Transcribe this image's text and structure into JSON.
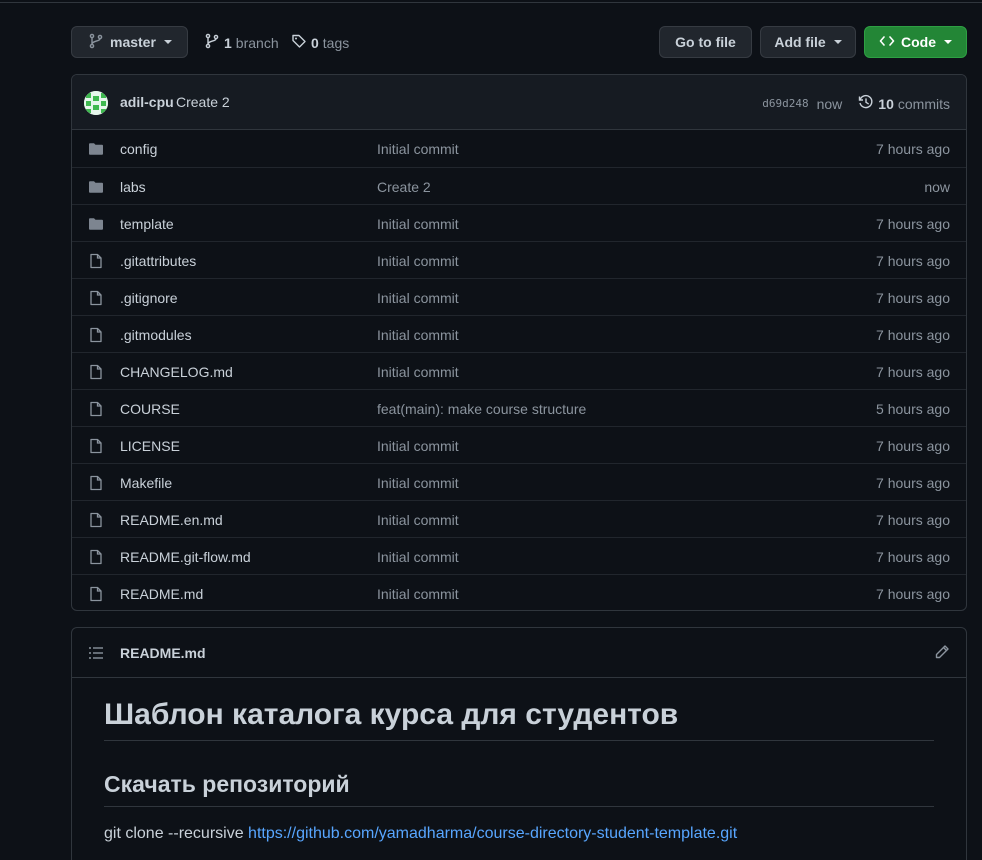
{
  "toolbar": {
    "branch": "master",
    "branches_count": "1",
    "branches_label": "branch",
    "tags_count": "0",
    "tags_label": "tags",
    "go_to_file": "Go to file",
    "add_file": "Add file",
    "code": "Code"
  },
  "commit": {
    "author": "adil-cpu",
    "message": "Create 2",
    "sha": "d69d248",
    "time": "now",
    "commits_count": "10",
    "commits_label": "commits"
  },
  "files": [
    {
      "name": "config",
      "type": "folder",
      "message": "Initial commit",
      "age": "7 hours ago"
    },
    {
      "name": "labs",
      "type": "folder",
      "message": "Create 2",
      "age": "now"
    },
    {
      "name": "template",
      "type": "folder",
      "message": "Initial commit",
      "age": "7 hours ago"
    },
    {
      "name": ".gitattributes",
      "type": "file",
      "message": "Initial commit",
      "age": "7 hours ago"
    },
    {
      "name": ".gitignore",
      "type": "file",
      "message": "Initial commit",
      "age": "7 hours ago"
    },
    {
      "name": ".gitmodules",
      "type": "file",
      "message": "Initial commit",
      "age": "7 hours ago"
    },
    {
      "name": "CHANGELOG.md",
      "type": "file",
      "message": "Initial commit",
      "age": "7 hours ago"
    },
    {
      "name": "COURSE",
      "type": "file",
      "message": "feat(main): make course structure",
      "age": "5 hours ago"
    },
    {
      "name": "LICENSE",
      "type": "file",
      "message": "Initial commit",
      "age": "7 hours ago"
    },
    {
      "name": "Makefile",
      "type": "file",
      "message": "Initial commit",
      "age": "7 hours ago"
    },
    {
      "name": "README.en.md",
      "type": "file",
      "message": "Initial commit",
      "age": "7 hours ago"
    },
    {
      "name": "README.git-flow.md",
      "type": "file",
      "message": "Initial commit",
      "age": "7 hours ago"
    },
    {
      "name": "README.md",
      "type": "file",
      "message": "Initial commit",
      "age": "7 hours ago"
    }
  ],
  "readme": {
    "filename": "README.md",
    "h1": "Шаблон каталога курса для студентов",
    "h2": "Скачать репозиторий",
    "clone_prefix": "git clone --recursive ",
    "clone_url": "https://github.com/yamadharma/course-directory-student-template.git"
  },
  "colors": {
    "background": "#0d1117",
    "code_button": "#238636",
    "link": "#58a6ff",
    "muted_text": "#8b949e"
  },
  "icons": {
    "branch": "git-branch-icon",
    "tag": "tag-icon",
    "folder": "folder-icon",
    "file": "file-icon",
    "history": "history-icon",
    "code": "code-icon",
    "list": "list-icon",
    "edit": "pencil-icon"
  }
}
